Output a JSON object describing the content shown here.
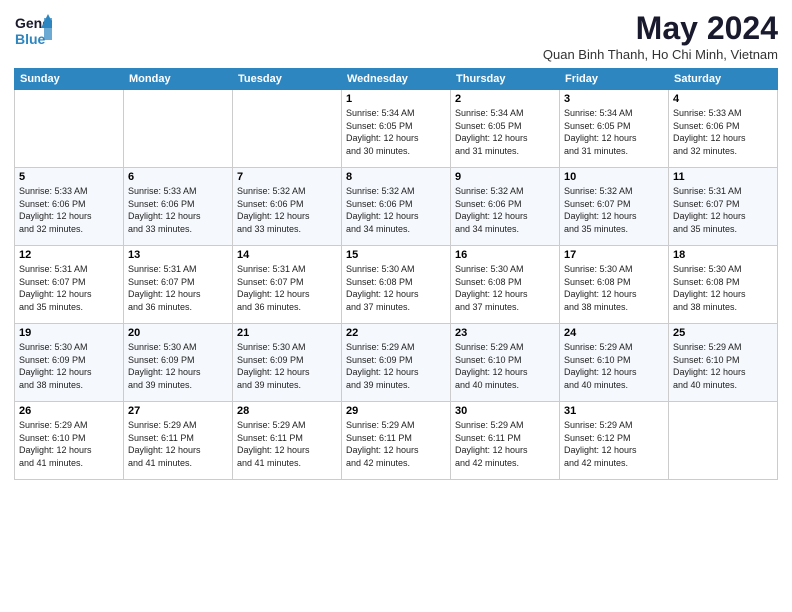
{
  "header": {
    "logo_general": "General",
    "logo_blue": "Blue",
    "month_year": "May 2024",
    "location": "Quan Binh Thanh, Ho Chi Minh, Vietnam"
  },
  "days_of_week": [
    "Sunday",
    "Monday",
    "Tuesday",
    "Wednesday",
    "Thursday",
    "Friday",
    "Saturday"
  ],
  "weeks": [
    {
      "cells": [
        {
          "day": null,
          "info": null
        },
        {
          "day": null,
          "info": null
        },
        {
          "day": null,
          "info": null
        },
        {
          "day": "1",
          "info": "Sunrise: 5:34 AM\nSunset: 6:05 PM\nDaylight: 12 hours\nand 30 minutes."
        },
        {
          "day": "2",
          "info": "Sunrise: 5:34 AM\nSunset: 6:05 PM\nDaylight: 12 hours\nand 31 minutes."
        },
        {
          "day": "3",
          "info": "Sunrise: 5:34 AM\nSunset: 6:05 PM\nDaylight: 12 hours\nand 31 minutes."
        },
        {
          "day": "4",
          "info": "Sunrise: 5:33 AM\nSunset: 6:06 PM\nDaylight: 12 hours\nand 32 minutes."
        }
      ]
    },
    {
      "cells": [
        {
          "day": "5",
          "info": "Sunrise: 5:33 AM\nSunset: 6:06 PM\nDaylight: 12 hours\nand 32 minutes."
        },
        {
          "day": "6",
          "info": "Sunrise: 5:33 AM\nSunset: 6:06 PM\nDaylight: 12 hours\nand 33 minutes."
        },
        {
          "day": "7",
          "info": "Sunrise: 5:32 AM\nSunset: 6:06 PM\nDaylight: 12 hours\nand 33 minutes."
        },
        {
          "day": "8",
          "info": "Sunrise: 5:32 AM\nSunset: 6:06 PM\nDaylight: 12 hours\nand 34 minutes."
        },
        {
          "day": "9",
          "info": "Sunrise: 5:32 AM\nSunset: 6:06 PM\nDaylight: 12 hours\nand 34 minutes."
        },
        {
          "day": "10",
          "info": "Sunrise: 5:32 AM\nSunset: 6:07 PM\nDaylight: 12 hours\nand 35 minutes."
        },
        {
          "day": "11",
          "info": "Sunrise: 5:31 AM\nSunset: 6:07 PM\nDaylight: 12 hours\nand 35 minutes."
        }
      ]
    },
    {
      "cells": [
        {
          "day": "12",
          "info": "Sunrise: 5:31 AM\nSunset: 6:07 PM\nDaylight: 12 hours\nand 35 minutes."
        },
        {
          "day": "13",
          "info": "Sunrise: 5:31 AM\nSunset: 6:07 PM\nDaylight: 12 hours\nand 36 minutes."
        },
        {
          "day": "14",
          "info": "Sunrise: 5:31 AM\nSunset: 6:07 PM\nDaylight: 12 hours\nand 36 minutes."
        },
        {
          "day": "15",
          "info": "Sunrise: 5:30 AM\nSunset: 6:08 PM\nDaylight: 12 hours\nand 37 minutes."
        },
        {
          "day": "16",
          "info": "Sunrise: 5:30 AM\nSunset: 6:08 PM\nDaylight: 12 hours\nand 37 minutes."
        },
        {
          "day": "17",
          "info": "Sunrise: 5:30 AM\nSunset: 6:08 PM\nDaylight: 12 hours\nand 38 minutes."
        },
        {
          "day": "18",
          "info": "Sunrise: 5:30 AM\nSunset: 6:08 PM\nDaylight: 12 hours\nand 38 minutes."
        }
      ]
    },
    {
      "cells": [
        {
          "day": "19",
          "info": "Sunrise: 5:30 AM\nSunset: 6:09 PM\nDaylight: 12 hours\nand 38 minutes."
        },
        {
          "day": "20",
          "info": "Sunrise: 5:30 AM\nSunset: 6:09 PM\nDaylight: 12 hours\nand 39 minutes."
        },
        {
          "day": "21",
          "info": "Sunrise: 5:30 AM\nSunset: 6:09 PM\nDaylight: 12 hours\nand 39 minutes."
        },
        {
          "day": "22",
          "info": "Sunrise: 5:29 AM\nSunset: 6:09 PM\nDaylight: 12 hours\nand 39 minutes."
        },
        {
          "day": "23",
          "info": "Sunrise: 5:29 AM\nSunset: 6:10 PM\nDaylight: 12 hours\nand 40 minutes."
        },
        {
          "day": "24",
          "info": "Sunrise: 5:29 AM\nSunset: 6:10 PM\nDaylight: 12 hours\nand 40 minutes."
        },
        {
          "day": "25",
          "info": "Sunrise: 5:29 AM\nSunset: 6:10 PM\nDaylight: 12 hours\nand 40 minutes."
        }
      ]
    },
    {
      "cells": [
        {
          "day": "26",
          "info": "Sunrise: 5:29 AM\nSunset: 6:10 PM\nDaylight: 12 hours\nand 41 minutes."
        },
        {
          "day": "27",
          "info": "Sunrise: 5:29 AM\nSunset: 6:11 PM\nDaylight: 12 hours\nand 41 minutes."
        },
        {
          "day": "28",
          "info": "Sunrise: 5:29 AM\nSunset: 6:11 PM\nDaylight: 12 hours\nand 41 minutes."
        },
        {
          "day": "29",
          "info": "Sunrise: 5:29 AM\nSunset: 6:11 PM\nDaylight: 12 hours\nand 42 minutes."
        },
        {
          "day": "30",
          "info": "Sunrise: 5:29 AM\nSunset: 6:11 PM\nDaylight: 12 hours\nand 42 minutes."
        },
        {
          "day": "31",
          "info": "Sunrise: 5:29 AM\nSunset: 6:12 PM\nDaylight: 12 hours\nand 42 minutes."
        },
        {
          "day": null,
          "info": null
        }
      ]
    }
  ]
}
